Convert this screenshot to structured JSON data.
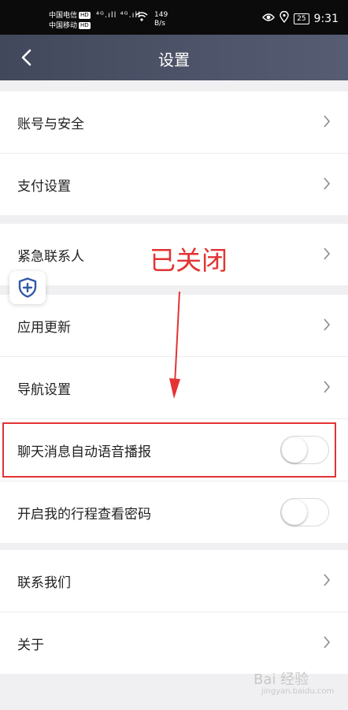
{
  "status_bar": {
    "carrier1": "中国电信",
    "carrier2": "中国移动",
    "hd": "HD",
    "signal": "⁴ᴳ.ıll ⁴ᴳ.ıll",
    "speed_value": "149",
    "speed_unit": "B/s",
    "battery": "25",
    "time": "9:31"
  },
  "nav": {
    "title": "设置"
  },
  "groups": [
    {
      "items": [
        {
          "label": "账号与安全"
        },
        {
          "label": "支付设置"
        }
      ]
    },
    {
      "items": [
        {
          "label": "紧急联系人"
        }
      ]
    },
    {
      "items": [
        {
          "label": "应用更新"
        },
        {
          "label": "导航设置"
        },
        {
          "label": "聊天消息自动语音播报",
          "toggle": false
        },
        {
          "label": "开启我的行程查看密码",
          "toggle": false
        }
      ]
    },
    {
      "items": [
        {
          "label": "联系我们"
        },
        {
          "label": "关于"
        }
      ]
    }
  ],
  "annotation": {
    "text": "已关闭",
    "color": "#e33333"
  },
  "watermark": {
    "text": "Bai 经验",
    "sub": "jingyan.baidu.com"
  }
}
